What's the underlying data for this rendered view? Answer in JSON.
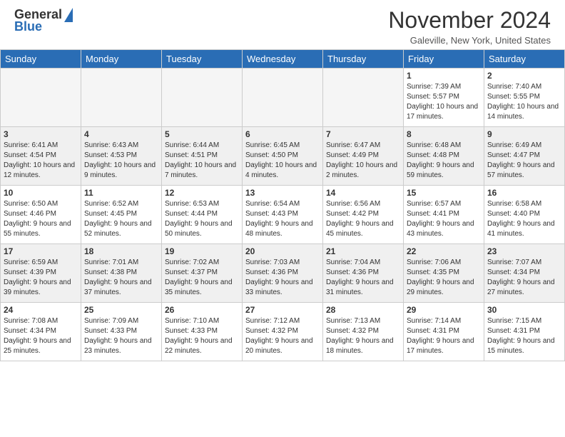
{
  "header": {
    "logo_general": "General",
    "logo_blue": "Blue",
    "title": "November 2024",
    "location": "Galeville, New York, United States"
  },
  "columns": [
    "Sunday",
    "Monday",
    "Tuesday",
    "Wednesday",
    "Thursday",
    "Friday",
    "Saturday"
  ],
  "weeks": [
    [
      {
        "day": "",
        "sunrise": "",
        "sunset": "",
        "daylight": ""
      },
      {
        "day": "",
        "sunrise": "",
        "sunset": "",
        "daylight": ""
      },
      {
        "day": "",
        "sunrise": "",
        "sunset": "",
        "daylight": ""
      },
      {
        "day": "",
        "sunrise": "",
        "sunset": "",
        "daylight": ""
      },
      {
        "day": "",
        "sunrise": "",
        "sunset": "",
        "daylight": ""
      },
      {
        "day": "1",
        "sunrise": "Sunrise: 7:39 AM",
        "sunset": "Sunset: 5:57 PM",
        "daylight": "Daylight: 10 hours and 17 minutes."
      },
      {
        "day": "2",
        "sunrise": "Sunrise: 7:40 AM",
        "sunset": "Sunset: 5:55 PM",
        "daylight": "Daylight: 10 hours and 14 minutes."
      }
    ],
    [
      {
        "day": "3",
        "sunrise": "Sunrise: 6:41 AM",
        "sunset": "Sunset: 4:54 PM",
        "daylight": "Daylight: 10 hours and 12 minutes."
      },
      {
        "day": "4",
        "sunrise": "Sunrise: 6:43 AM",
        "sunset": "Sunset: 4:53 PM",
        "daylight": "Daylight: 10 hours and 9 minutes."
      },
      {
        "day": "5",
        "sunrise": "Sunrise: 6:44 AM",
        "sunset": "Sunset: 4:51 PM",
        "daylight": "Daylight: 10 hours and 7 minutes."
      },
      {
        "day": "6",
        "sunrise": "Sunrise: 6:45 AM",
        "sunset": "Sunset: 4:50 PM",
        "daylight": "Daylight: 10 hours and 4 minutes."
      },
      {
        "day": "7",
        "sunrise": "Sunrise: 6:47 AM",
        "sunset": "Sunset: 4:49 PM",
        "daylight": "Daylight: 10 hours and 2 minutes."
      },
      {
        "day": "8",
        "sunrise": "Sunrise: 6:48 AM",
        "sunset": "Sunset: 4:48 PM",
        "daylight": "Daylight: 9 hours and 59 minutes."
      },
      {
        "day": "9",
        "sunrise": "Sunrise: 6:49 AM",
        "sunset": "Sunset: 4:47 PM",
        "daylight": "Daylight: 9 hours and 57 minutes."
      }
    ],
    [
      {
        "day": "10",
        "sunrise": "Sunrise: 6:50 AM",
        "sunset": "Sunset: 4:46 PM",
        "daylight": "Daylight: 9 hours and 55 minutes."
      },
      {
        "day": "11",
        "sunrise": "Sunrise: 6:52 AM",
        "sunset": "Sunset: 4:45 PM",
        "daylight": "Daylight: 9 hours and 52 minutes."
      },
      {
        "day": "12",
        "sunrise": "Sunrise: 6:53 AM",
        "sunset": "Sunset: 4:44 PM",
        "daylight": "Daylight: 9 hours and 50 minutes."
      },
      {
        "day": "13",
        "sunrise": "Sunrise: 6:54 AM",
        "sunset": "Sunset: 4:43 PM",
        "daylight": "Daylight: 9 hours and 48 minutes."
      },
      {
        "day": "14",
        "sunrise": "Sunrise: 6:56 AM",
        "sunset": "Sunset: 4:42 PM",
        "daylight": "Daylight: 9 hours and 45 minutes."
      },
      {
        "day": "15",
        "sunrise": "Sunrise: 6:57 AM",
        "sunset": "Sunset: 4:41 PM",
        "daylight": "Daylight: 9 hours and 43 minutes."
      },
      {
        "day": "16",
        "sunrise": "Sunrise: 6:58 AM",
        "sunset": "Sunset: 4:40 PM",
        "daylight": "Daylight: 9 hours and 41 minutes."
      }
    ],
    [
      {
        "day": "17",
        "sunrise": "Sunrise: 6:59 AM",
        "sunset": "Sunset: 4:39 PM",
        "daylight": "Daylight: 9 hours and 39 minutes."
      },
      {
        "day": "18",
        "sunrise": "Sunrise: 7:01 AM",
        "sunset": "Sunset: 4:38 PM",
        "daylight": "Daylight: 9 hours and 37 minutes."
      },
      {
        "day": "19",
        "sunrise": "Sunrise: 7:02 AM",
        "sunset": "Sunset: 4:37 PM",
        "daylight": "Daylight: 9 hours and 35 minutes."
      },
      {
        "day": "20",
        "sunrise": "Sunrise: 7:03 AM",
        "sunset": "Sunset: 4:36 PM",
        "daylight": "Daylight: 9 hours and 33 minutes."
      },
      {
        "day": "21",
        "sunrise": "Sunrise: 7:04 AM",
        "sunset": "Sunset: 4:36 PM",
        "daylight": "Daylight: 9 hours and 31 minutes."
      },
      {
        "day": "22",
        "sunrise": "Sunrise: 7:06 AM",
        "sunset": "Sunset: 4:35 PM",
        "daylight": "Daylight: 9 hours and 29 minutes."
      },
      {
        "day": "23",
        "sunrise": "Sunrise: 7:07 AM",
        "sunset": "Sunset: 4:34 PM",
        "daylight": "Daylight: 9 hours and 27 minutes."
      }
    ],
    [
      {
        "day": "24",
        "sunrise": "Sunrise: 7:08 AM",
        "sunset": "Sunset: 4:34 PM",
        "daylight": "Daylight: 9 hours and 25 minutes."
      },
      {
        "day": "25",
        "sunrise": "Sunrise: 7:09 AM",
        "sunset": "Sunset: 4:33 PM",
        "daylight": "Daylight: 9 hours and 23 minutes."
      },
      {
        "day": "26",
        "sunrise": "Sunrise: 7:10 AM",
        "sunset": "Sunset: 4:33 PM",
        "daylight": "Daylight: 9 hours and 22 minutes."
      },
      {
        "day": "27",
        "sunrise": "Sunrise: 7:12 AM",
        "sunset": "Sunset: 4:32 PM",
        "daylight": "Daylight: 9 hours and 20 minutes."
      },
      {
        "day": "28",
        "sunrise": "Sunrise: 7:13 AM",
        "sunset": "Sunset: 4:32 PM",
        "daylight": "Daylight: 9 hours and 18 minutes."
      },
      {
        "day": "29",
        "sunrise": "Sunrise: 7:14 AM",
        "sunset": "Sunset: 4:31 PM",
        "daylight": "Daylight: 9 hours and 17 minutes."
      },
      {
        "day": "30",
        "sunrise": "Sunrise: 7:15 AM",
        "sunset": "Sunset: 4:31 PM",
        "daylight": "Daylight: 9 hours and 15 minutes."
      }
    ]
  ]
}
